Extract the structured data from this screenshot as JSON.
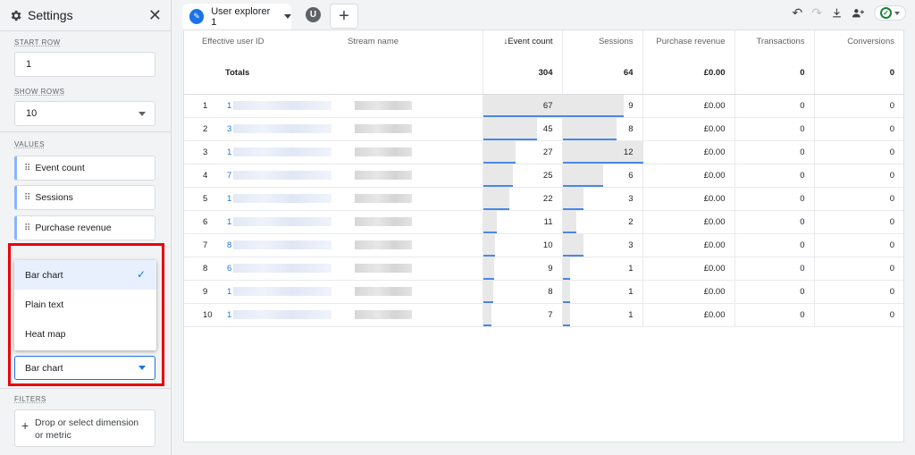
{
  "sidebar": {
    "title": "Settings",
    "start_row": {
      "label": "START ROW",
      "value": "1"
    },
    "show_rows": {
      "label": "SHOW ROWS",
      "value": "10"
    },
    "values": {
      "label": "VALUES",
      "items": [
        "Event count",
        "Sessions",
        "Purchase revenue"
      ]
    },
    "display_type": {
      "options": [
        "Bar chart",
        "Plain text",
        "Heat map"
      ],
      "selected": "Bar chart"
    },
    "filters": {
      "label": "FILTERS",
      "placeholder": "Drop or select dimension or metric"
    }
  },
  "tabs": [
    {
      "label": "User explorer 1"
    }
  ],
  "avatar_initial": "U",
  "table": {
    "columns": [
      "Effective user ID",
      "Stream name",
      "Event count",
      "Sessions",
      "Purchase revenue",
      "Transactions",
      "Conversions"
    ],
    "sorted_column": "Event count",
    "totals": {
      "label": "Totals",
      "event_count": "304",
      "sessions": "64",
      "purchase_revenue": "£0.00",
      "transactions": "0",
      "conversions": "0"
    },
    "max_event_count": 67,
    "max_sessions": 12,
    "rows": [
      {
        "index": "1",
        "uid_prefix": "1",
        "event_count": 67,
        "sessions": 9,
        "purchase_revenue": "£0.00",
        "transactions": "0",
        "conversions": "0"
      },
      {
        "index": "2",
        "uid_prefix": "3",
        "event_count": 45,
        "sessions": 8,
        "purchase_revenue": "£0.00",
        "transactions": "0",
        "conversions": "0"
      },
      {
        "index": "3",
        "uid_prefix": "1",
        "event_count": 27,
        "sessions": 12,
        "purchase_revenue": "£0.00",
        "transactions": "0",
        "conversions": "0"
      },
      {
        "index": "4",
        "uid_prefix": "7",
        "event_count": 25,
        "sessions": 6,
        "purchase_revenue": "£0.00",
        "transactions": "0",
        "conversions": "0"
      },
      {
        "index": "5",
        "uid_prefix": "1",
        "event_count": 22,
        "sessions": 3,
        "purchase_revenue": "£0.00",
        "transactions": "0",
        "conversions": "0"
      },
      {
        "index": "6",
        "uid_prefix": "1",
        "event_count": 11,
        "sessions": 2,
        "purchase_revenue": "£0.00",
        "transactions": "0",
        "conversions": "0"
      },
      {
        "index": "7",
        "uid_prefix": "8",
        "event_count": 10,
        "sessions": 3,
        "purchase_revenue": "£0.00",
        "transactions": "0",
        "conversions": "0"
      },
      {
        "index": "8",
        "uid_prefix": "6",
        "event_count": 9,
        "sessions": 1,
        "purchase_revenue": "£0.00",
        "transactions": "0",
        "conversions": "0"
      },
      {
        "index": "9",
        "uid_prefix": "1",
        "event_count": 8,
        "sessions": 1,
        "purchase_revenue": "£0.00",
        "transactions": "0",
        "conversions": "0"
      },
      {
        "index": "10",
        "uid_prefix": "1",
        "event_count": 7,
        "sessions": 1,
        "purchase_revenue": "£0.00",
        "transactions": "0",
        "conversions": "0"
      }
    ]
  },
  "colors": {
    "accent": "#1a73e8",
    "bar_line": "#4a86e8",
    "highlight": "#e8000b"
  }
}
